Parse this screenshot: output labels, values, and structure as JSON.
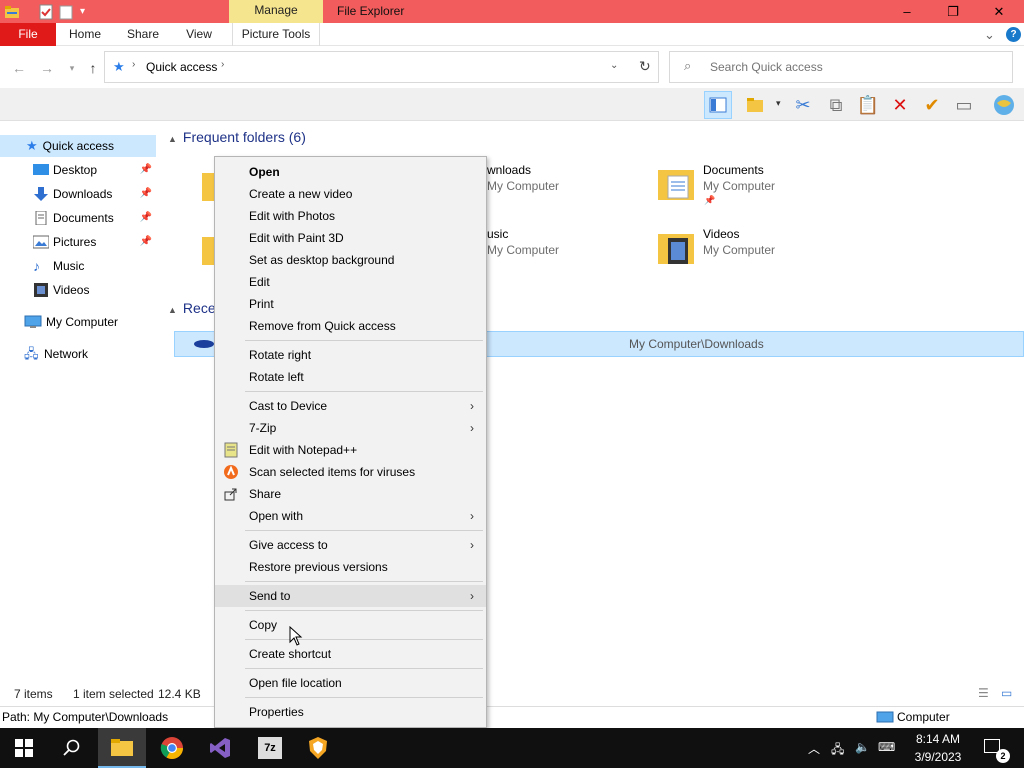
{
  "window": {
    "title": "File Explorer",
    "contextual_tab": "Manage",
    "minimize": "–",
    "maximize": "❐",
    "close": "✕"
  },
  "ribbon": {
    "tabs": [
      "File",
      "Home",
      "Share",
      "View",
      "Picture Tools"
    ],
    "chevron": "⌄",
    "help": "?"
  },
  "address": {
    "crumb": "Quick access",
    "search_placeholder": "Search Quick access"
  },
  "nav": {
    "items": [
      {
        "label": "Quick access",
        "icon": "star-icon",
        "selected": true
      },
      {
        "label": "Desktop",
        "icon": "desktop-icon",
        "pinned": true
      },
      {
        "label": "Downloads",
        "icon": "download-icon",
        "pinned": true
      },
      {
        "label": "Documents",
        "icon": "document-icon",
        "pinned": true
      },
      {
        "label": "Pictures",
        "icon": "picture-icon",
        "pinned": true
      },
      {
        "label": "Music",
        "icon": "music-icon"
      },
      {
        "label": "Videos",
        "icon": "video-icon"
      },
      {
        "label": "My Computer",
        "icon": "computer-icon"
      },
      {
        "label": "Network",
        "icon": "network-icon"
      }
    ]
  },
  "content": {
    "frequent_header": "Frequent folders (6)",
    "recent_header": "Rece",
    "folders": [
      {
        "name": "wnloads",
        "sub": "My Computer"
      },
      {
        "name": "Documents",
        "sub": "My Computer"
      },
      {
        "name": "usic",
        "sub": "My Computer"
      },
      {
        "name": "Videos",
        "sub": "My Computer"
      }
    ],
    "recent_row_path": "My Computer\\Downloads"
  },
  "status": {
    "items": "7 items",
    "selected": "1 item selected",
    "size": "12.4 KB",
    "path": "Path: My Computer\\Downloads",
    "location": "Computer"
  },
  "context_menu": {
    "items": [
      {
        "label": "Open",
        "bold": true
      },
      {
        "label": "Create a new video"
      },
      {
        "label": "Edit with Photos"
      },
      {
        "label": "Edit with Paint 3D"
      },
      {
        "label": "Set as desktop background"
      },
      {
        "label": "Edit"
      },
      {
        "label": "Print"
      },
      {
        "label": "Remove from Quick access"
      },
      {
        "label": "Rotate right"
      },
      {
        "label": "Rotate left"
      },
      {
        "label": "Cast to Device",
        "submenu": true
      },
      {
        "label": "7-Zip",
        "submenu": true
      },
      {
        "label": "Edit with Notepad++"
      },
      {
        "label": "Scan selected items for viruses"
      },
      {
        "label": "Share"
      },
      {
        "label": "Open with",
        "submenu": true
      },
      {
        "label": "Give access to",
        "submenu": true
      },
      {
        "label": "Restore previous versions"
      },
      {
        "label": "Send to",
        "submenu": true
      },
      {
        "label": "Copy"
      },
      {
        "label": "Create shortcut"
      },
      {
        "label": "Open file location"
      },
      {
        "label": "Properties"
      }
    ]
  },
  "taskbar": {
    "time": "8:14 AM",
    "date": "3/9/2023",
    "notification_count": "2"
  },
  "colors": {
    "titlebar": "#f25c5c",
    "manage_tab": "#f6e58f",
    "file_tab": "#e01919",
    "selection": "#cce8ff",
    "taskbar": "#101010"
  }
}
